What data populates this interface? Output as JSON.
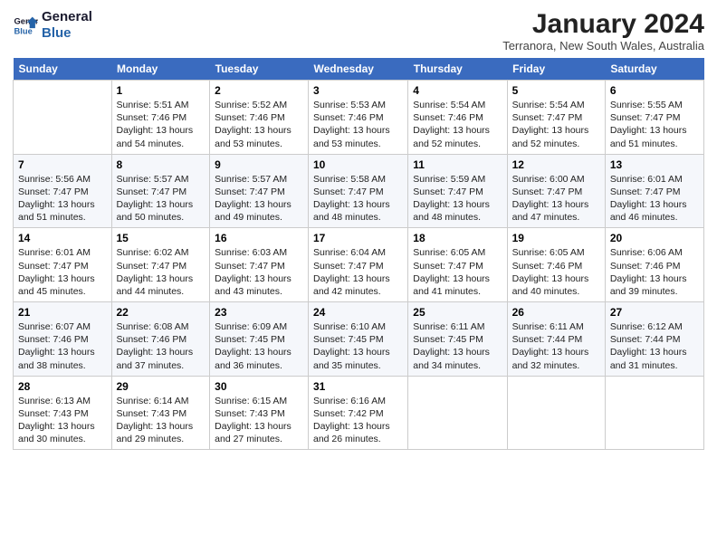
{
  "logo": {
    "line1": "General",
    "line2": "Blue"
  },
  "title": "January 2024",
  "subtitle": "Terranora, New South Wales, Australia",
  "days_header": [
    "Sunday",
    "Monday",
    "Tuesday",
    "Wednesday",
    "Thursday",
    "Friday",
    "Saturday"
  ],
  "weeks": [
    [
      {
        "num": "",
        "text": ""
      },
      {
        "num": "1",
        "text": "Sunrise: 5:51 AM\nSunset: 7:46 PM\nDaylight: 13 hours\nand 54 minutes."
      },
      {
        "num": "2",
        "text": "Sunrise: 5:52 AM\nSunset: 7:46 PM\nDaylight: 13 hours\nand 53 minutes."
      },
      {
        "num": "3",
        "text": "Sunrise: 5:53 AM\nSunset: 7:46 PM\nDaylight: 13 hours\nand 53 minutes."
      },
      {
        "num": "4",
        "text": "Sunrise: 5:54 AM\nSunset: 7:46 PM\nDaylight: 13 hours\nand 52 minutes."
      },
      {
        "num": "5",
        "text": "Sunrise: 5:54 AM\nSunset: 7:47 PM\nDaylight: 13 hours\nand 52 minutes."
      },
      {
        "num": "6",
        "text": "Sunrise: 5:55 AM\nSunset: 7:47 PM\nDaylight: 13 hours\nand 51 minutes."
      }
    ],
    [
      {
        "num": "7",
        "text": "Sunrise: 5:56 AM\nSunset: 7:47 PM\nDaylight: 13 hours\nand 51 minutes."
      },
      {
        "num": "8",
        "text": "Sunrise: 5:57 AM\nSunset: 7:47 PM\nDaylight: 13 hours\nand 50 minutes."
      },
      {
        "num": "9",
        "text": "Sunrise: 5:57 AM\nSunset: 7:47 PM\nDaylight: 13 hours\nand 49 minutes."
      },
      {
        "num": "10",
        "text": "Sunrise: 5:58 AM\nSunset: 7:47 PM\nDaylight: 13 hours\nand 48 minutes."
      },
      {
        "num": "11",
        "text": "Sunrise: 5:59 AM\nSunset: 7:47 PM\nDaylight: 13 hours\nand 48 minutes."
      },
      {
        "num": "12",
        "text": "Sunrise: 6:00 AM\nSunset: 7:47 PM\nDaylight: 13 hours\nand 47 minutes."
      },
      {
        "num": "13",
        "text": "Sunrise: 6:01 AM\nSunset: 7:47 PM\nDaylight: 13 hours\nand 46 minutes."
      }
    ],
    [
      {
        "num": "14",
        "text": "Sunrise: 6:01 AM\nSunset: 7:47 PM\nDaylight: 13 hours\nand 45 minutes."
      },
      {
        "num": "15",
        "text": "Sunrise: 6:02 AM\nSunset: 7:47 PM\nDaylight: 13 hours\nand 44 minutes."
      },
      {
        "num": "16",
        "text": "Sunrise: 6:03 AM\nSunset: 7:47 PM\nDaylight: 13 hours\nand 43 minutes."
      },
      {
        "num": "17",
        "text": "Sunrise: 6:04 AM\nSunset: 7:47 PM\nDaylight: 13 hours\nand 42 minutes."
      },
      {
        "num": "18",
        "text": "Sunrise: 6:05 AM\nSunset: 7:47 PM\nDaylight: 13 hours\nand 41 minutes."
      },
      {
        "num": "19",
        "text": "Sunrise: 6:05 AM\nSunset: 7:46 PM\nDaylight: 13 hours\nand 40 minutes."
      },
      {
        "num": "20",
        "text": "Sunrise: 6:06 AM\nSunset: 7:46 PM\nDaylight: 13 hours\nand 39 minutes."
      }
    ],
    [
      {
        "num": "21",
        "text": "Sunrise: 6:07 AM\nSunset: 7:46 PM\nDaylight: 13 hours\nand 38 minutes."
      },
      {
        "num": "22",
        "text": "Sunrise: 6:08 AM\nSunset: 7:46 PM\nDaylight: 13 hours\nand 37 minutes."
      },
      {
        "num": "23",
        "text": "Sunrise: 6:09 AM\nSunset: 7:45 PM\nDaylight: 13 hours\nand 36 minutes."
      },
      {
        "num": "24",
        "text": "Sunrise: 6:10 AM\nSunset: 7:45 PM\nDaylight: 13 hours\nand 35 minutes."
      },
      {
        "num": "25",
        "text": "Sunrise: 6:11 AM\nSunset: 7:45 PM\nDaylight: 13 hours\nand 34 minutes."
      },
      {
        "num": "26",
        "text": "Sunrise: 6:11 AM\nSunset: 7:44 PM\nDaylight: 13 hours\nand 32 minutes."
      },
      {
        "num": "27",
        "text": "Sunrise: 6:12 AM\nSunset: 7:44 PM\nDaylight: 13 hours\nand 31 minutes."
      }
    ],
    [
      {
        "num": "28",
        "text": "Sunrise: 6:13 AM\nSunset: 7:43 PM\nDaylight: 13 hours\nand 30 minutes."
      },
      {
        "num": "29",
        "text": "Sunrise: 6:14 AM\nSunset: 7:43 PM\nDaylight: 13 hours\nand 29 minutes."
      },
      {
        "num": "30",
        "text": "Sunrise: 6:15 AM\nSunset: 7:43 PM\nDaylight: 13 hours\nand 27 minutes."
      },
      {
        "num": "31",
        "text": "Sunrise: 6:16 AM\nSunset: 7:42 PM\nDaylight: 13 hours\nand 26 minutes."
      },
      {
        "num": "",
        "text": ""
      },
      {
        "num": "",
        "text": ""
      },
      {
        "num": "",
        "text": ""
      }
    ]
  ]
}
